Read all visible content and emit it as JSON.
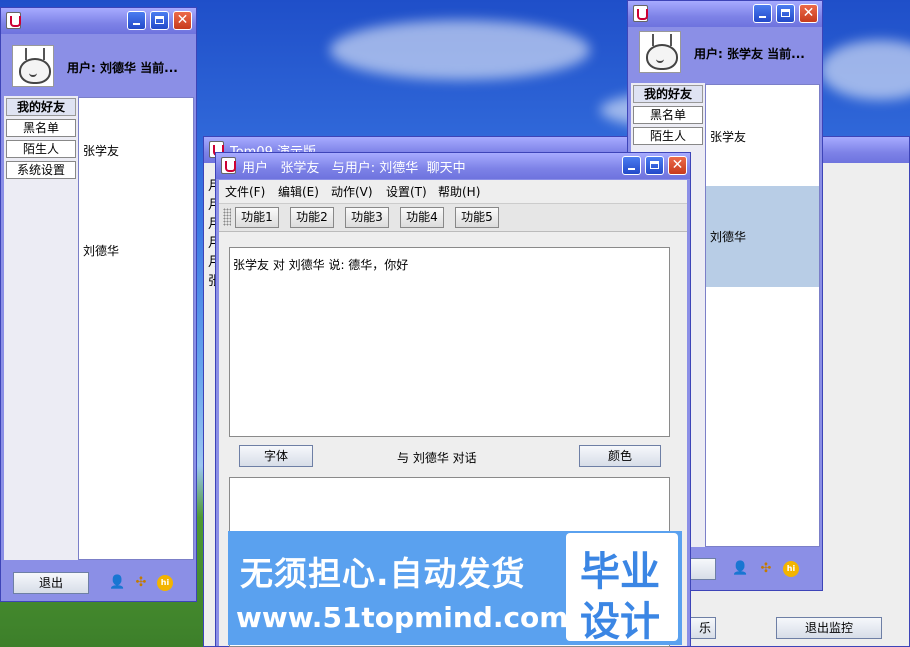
{
  "left_window": {
    "user_label": "用户: 刘德华 当前...",
    "tabs": [
      "我的好友",
      "黑名单",
      "陌生人",
      "系统设置"
    ],
    "friends": [
      "张学友",
      "刘德华"
    ],
    "exit_button": "退出"
  },
  "right_window": {
    "user_label": "用户: 张学友 当前...",
    "tabs": [
      "我的好友",
      "黑名单",
      "陌生人"
    ],
    "friends": [
      "张学友",
      "刘德华"
    ]
  },
  "behind_window": {
    "title": "Tom09 演示版",
    "partial_lines": [
      "月",
      "月",
      "月",
      "月",
      "月",
      "张"
    ],
    "button_partial": "乐",
    "exit_monitor_button": "退出监控"
  },
  "chat_window": {
    "title": "用户   张学友   与用户: 刘德华  聊天中",
    "menu": [
      "文件(F)",
      "编辑(E)",
      "动作(V)",
      "设置(T)",
      "帮助(H)"
    ],
    "functions": [
      "功能1",
      "功能2",
      "功能3",
      "功能4",
      "功能5"
    ],
    "message": "张学友 对 刘德华 说: 德华，你好",
    "font_button": "字体",
    "dialog_label": "与 刘德华 对话",
    "color_button": "颜色"
  },
  "banner": {
    "line1": "无须担心.自动发货",
    "line2": "www.51topmind.com",
    "badge_top": "毕业",
    "badge_bottom": "设计"
  },
  "colors": {
    "window_frame": "#8b8fe6",
    "titlebar": "#7d82e7",
    "selected_row": "#b8cde6",
    "banner": "#5aa1ef"
  }
}
